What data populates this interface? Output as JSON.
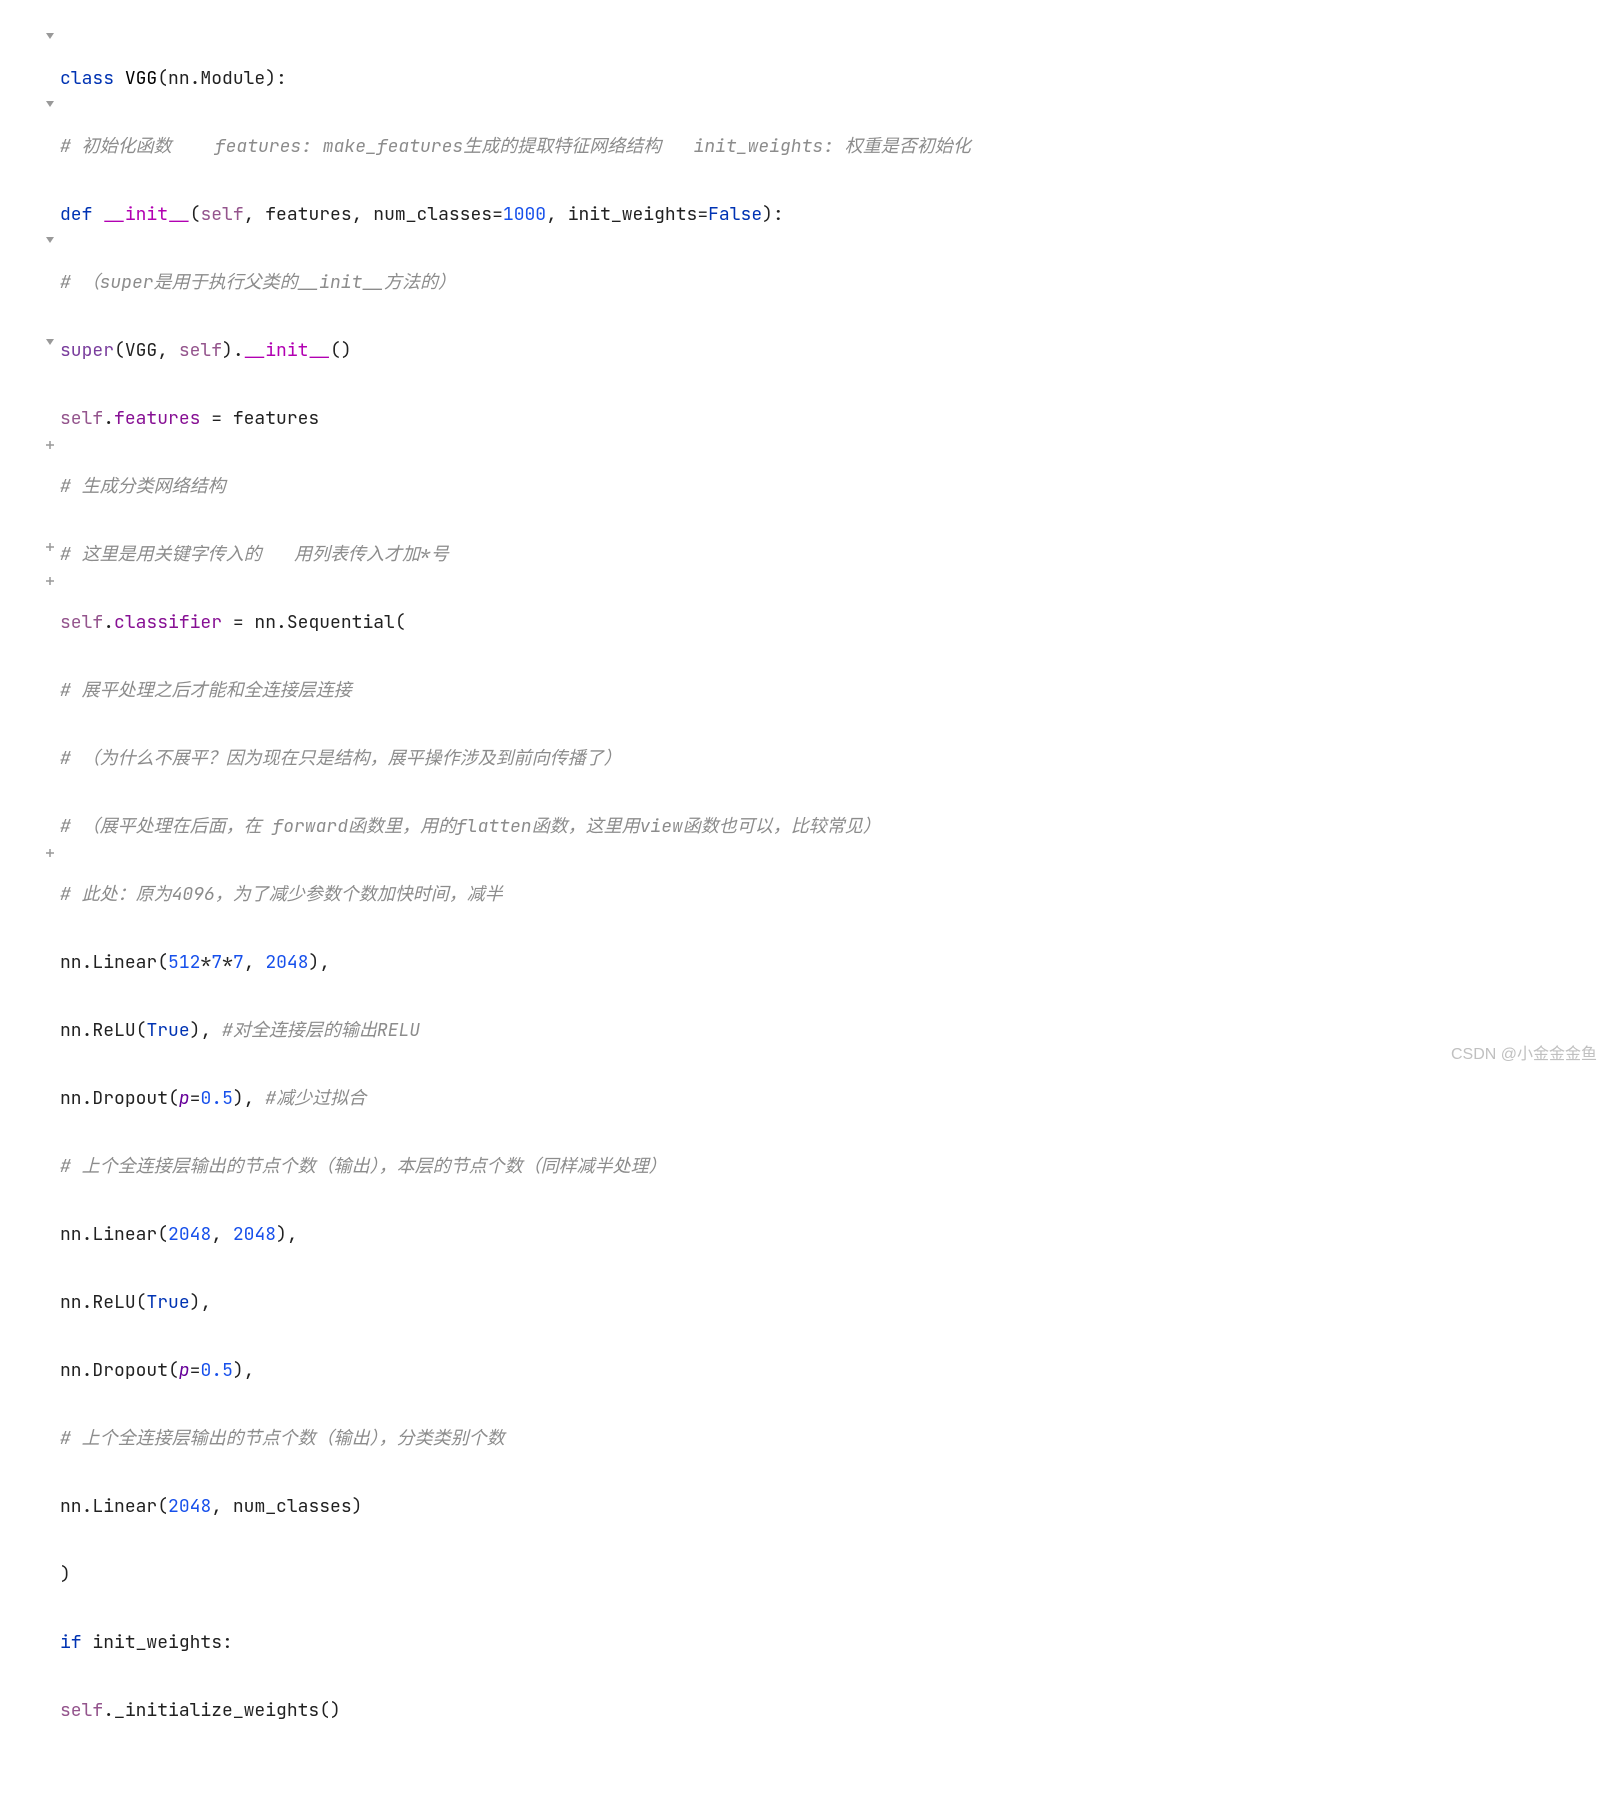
{
  "code": {
    "l1": {
      "kw_class": "class",
      "cls_name": "VGG",
      "base": "nn.Module"
    },
    "l2": {
      "comment": "# 初始化函数    features: make_features生成的提取特征网络结构   init_weights: 权重是否初始化"
    },
    "l3": {
      "kw_def": "def",
      "fn_name": "__init__",
      "p_self": "self",
      "p_features": "features",
      "p_num_classes": "num_classes",
      "v_1000": "1000",
      "p_init_weights": "init_weights",
      "v_false": "False"
    },
    "l4": {
      "comment": "# （super是用于执行父类的__init__方法的）"
    },
    "l5": {
      "super": "super",
      "cls": "VGG",
      "self": "self",
      "init": "__init__"
    },
    "l6": {
      "self": "self",
      "features_l": "features",
      "features_r": "features"
    },
    "l7": {
      "comment": "# 生成分类网络结构"
    },
    "l8": {
      "comment": "# 这里是用关键字传入的   用列表传入才加*号"
    },
    "l9": {
      "self": "self",
      "classifier": "classifier",
      "nn": "nn",
      "seq": "Sequential"
    },
    "l10": {
      "comment": "# 展平处理之后才能和全连接层连接"
    },
    "l11": {
      "comment": "# （为什么不展平？因为现在只是结构，展平操作涉及到前向传播了）"
    },
    "l12": {
      "comment": "# （展平处理在后面，在 forward函数里，用的flatten函数，这里用view函数也可以，比较常见）"
    },
    "l13": {
      "comment": "# 此处：原为4096，为了减少参数个数加快时间，减半"
    },
    "l14": {
      "nn": "nn",
      "linear": "Linear",
      "n512": "512",
      "n7a": "7",
      "n7b": "7",
      "n2048": "2048"
    },
    "l15": {
      "nn": "nn",
      "relu": "ReLU",
      "true": "True",
      "comment": "#对全连接层的输出RELU"
    },
    "l16": {
      "nn": "nn",
      "dropout": "Dropout",
      "p": "p",
      "v05": "0.5",
      "comment": "#减少过拟合"
    },
    "l17": {
      "comment": "# 上个全连接层输出的节点个数（输出），本层的节点个数（同样减半处理）"
    },
    "l18": {
      "nn": "nn",
      "linear": "Linear",
      "a": "2048",
      "b": "2048"
    },
    "l19": {
      "nn": "nn",
      "relu": "ReLU",
      "true": "True"
    },
    "l20": {
      "nn": "nn",
      "dropout": "Dropout",
      "p": "p",
      "v05": "0.5"
    },
    "l21": {
      "comment": "# 上个全连接层输出的节点个数（输出），分类类别个数"
    },
    "l22": {
      "nn": "nn",
      "linear": "Linear",
      "a": "2048",
      "b": "num_classes"
    },
    "l23": {
      "close": ")"
    },
    "l24": {
      "kw_if": "if",
      "cond": "init_weights"
    },
    "l25": {
      "self": "self",
      "method": "_initialize_weights"
    }
  },
  "watermark": "CSDN @小金金金鱼"
}
